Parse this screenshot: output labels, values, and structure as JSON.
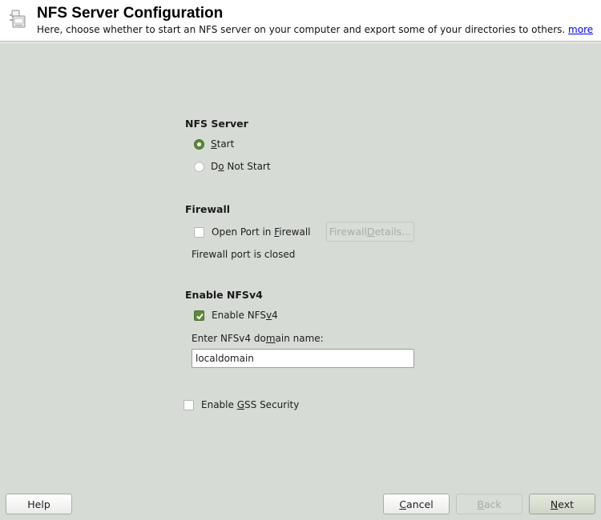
{
  "header": {
    "title": "NFS Server Configuration",
    "subtitle": "Here, choose whether to start an NFS server on your computer and export some of your directories to others.",
    "more_link": "more",
    "icon": "nfs-server-icon"
  },
  "nfs_server": {
    "title": "NFS Server",
    "options": [
      {
        "label_pre": "",
        "mnemonic": "S",
        "label_post": "tart",
        "selected": true
      },
      {
        "label_pre": "D",
        "mnemonic": "o",
        "label_post": " Not Start",
        "selected": false
      }
    ]
  },
  "firewall": {
    "title": "Firewall",
    "open_port": {
      "label_pre": "Open Port in ",
      "mnemonic": "F",
      "label_post": "irewall",
      "checked": false
    },
    "details_button": {
      "label_pre": "Firewall ",
      "mnemonic": "D",
      "label_post": "etails...",
      "enabled": false
    },
    "status": "Firewall port is closed"
  },
  "nfsv4": {
    "title": "Enable NFSv4",
    "enable": {
      "label_pre": "Enable NFS",
      "mnemonic": "v",
      "label_post": "4",
      "checked": true
    },
    "domain_label": {
      "label_pre": "Enter NFSv4 do",
      "mnemonic": "m",
      "label_post": "ain name:"
    },
    "domain_value": "localdomain"
  },
  "gss": {
    "label_pre": "Enable ",
    "mnemonic": "G",
    "label_post": "SS Security",
    "checked": false
  },
  "footer": {
    "help": "Help",
    "cancel": {
      "mnemonic": "C",
      "label_post": "ancel"
    },
    "back": {
      "mnemonic": "B",
      "label_post": "ack",
      "enabled": false
    },
    "next": {
      "mnemonic": "N",
      "label_post": "ext"
    }
  }
}
